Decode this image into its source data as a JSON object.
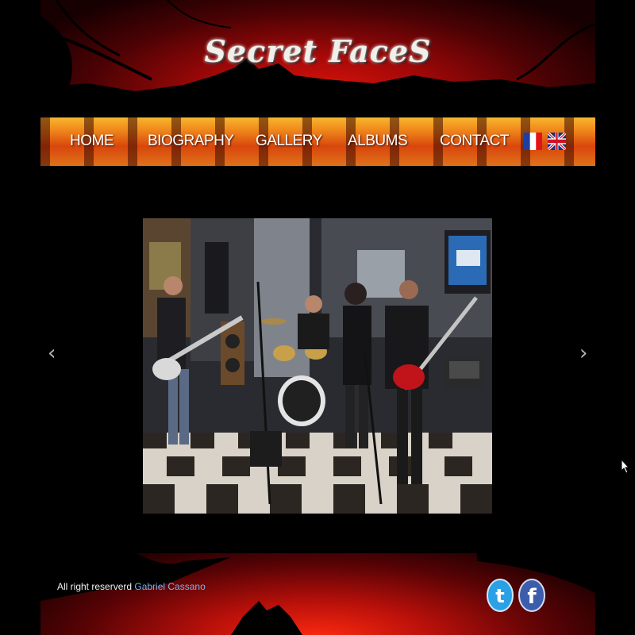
{
  "site": {
    "logo_text": "Secret FaceS"
  },
  "nav": {
    "items": [
      "HOME",
      "BIOGRAPHY",
      "GALLERY",
      "ALBUMS",
      "CONTACT"
    ],
    "languages": [
      "fr-flag-icon",
      "uk-flag-icon"
    ]
  },
  "slider": {
    "prev_label": "‹",
    "next_label": "›",
    "slide_description_icon": "band-photo"
  },
  "footer": {
    "copyright_text": "All right reserverd",
    "author_link": "Gabriel Cassano",
    "social": [
      "twitter-icon",
      "facebook-icon"
    ]
  },
  "colors": {
    "accent_red": "#c80c08",
    "nav_orange": "#f08a1c",
    "link_blue": "#7fb1e8"
  }
}
